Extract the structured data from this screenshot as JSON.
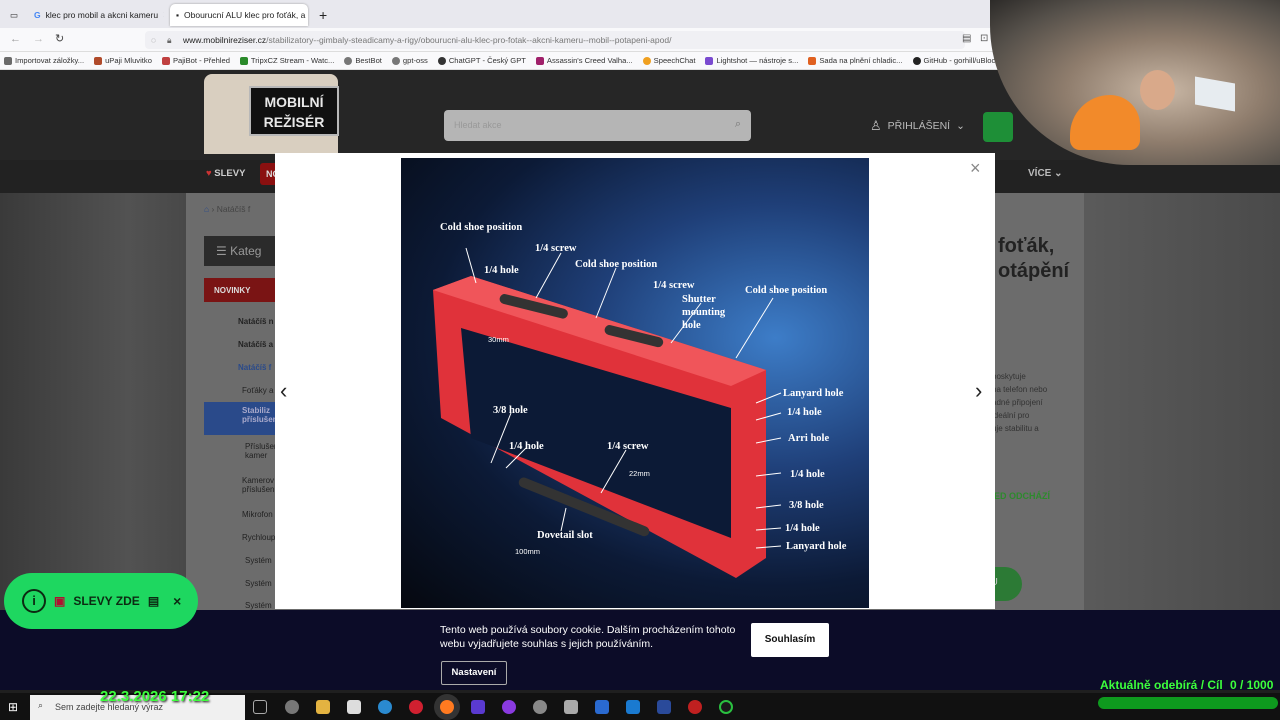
{
  "browser": {
    "tabs": [
      {
        "label": "klec pro mobil a akcni kameru"
      },
      {
        "label": "Obourucní ALU klec pro foťák, a"
      }
    ],
    "url_domain": "www.mobilnireziser.cz",
    "url_path": "/stabilizatory--gimbaly-steadicamy-a-rigy/obourucni-alu-klec-pro-fotak--akcni-kameru--mobil--potapeni-apod/",
    "bookmarks": [
      "Importovat záložky...",
      "uPaji Mluvitko",
      "PajiBot - Přehled",
      "TripxCZ Stream - Watc...",
      "BestBot",
      "gpt-oss",
      "ChatGPT - Český GPT",
      "Assassin's Creed Valha...",
      "SpeechChat",
      "Lightshot — nástroje s...",
      "Sada na plnění chladic...",
      "GitHub - gorhill/uBloc..."
    ]
  },
  "site": {
    "logo_line1": "MOBILNÍ",
    "logo_line2": "REŽISÉR",
    "search_placeholder": "Hledat akce",
    "login": "PŘIHLÁŠENÍ",
    "nav_slevy": "SLEVY",
    "nav_novinky": "NO",
    "nav_vice": "VÍCE",
    "breadcrumb": "Natáčíš f",
    "category_title": "Kateg",
    "sidebar": {
      "novinky": "NOVINKY",
      "items": [
        "Natáčíš n",
        "Natáčíš a",
        "Natáčíš f",
        "Foťáky a",
        "Stabiliz příslušen",
        "Příslušen kamer",
        "Kamerov příslušen",
        "Mikrofon",
        "Rychloup",
        "Systém",
        "Systém",
        "Systém"
      ]
    },
    "product_title_1": "foťák,",
    "product_title_2": "otápění",
    "product_desc": [
      "poskytuje",
      "na telefon nebo",
      "adné připojení",
      "ideální pro",
      "uje stabilitu a"
    ],
    "stock": "ED ODCHÁZÍ",
    "buy": "KU"
  },
  "gallery": {
    "close_label": "×",
    "prev_label": "‹",
    "next_label": "›",
    "labels": [
      "Cold shoe position",
      "1/4 screw",
      "1/4 hole",
      "Cold shoe position",
      "1/4 screw",
      "Shutter mounting hole",
      "Cold shoe position",
      "Lanyard hole",
      "1/4 hole",
      "Arri hole",
      "1/4 hole",
      "3/8 hole",
      "1/4 hole",
      "Lanyard hole",
      "3/8 hole",
      "1/4 hole",
      "1/4 screw",
      "Dovetail slot"
    ],
    "dims": [
      "30mm",
      "22mm",
      "100mm"
    ]
  },
  "cookie": {
    "text": "Tento web používá soubory cookie. Dalším procházením tohoto webu vyjadřujete souhlas s jejich používáním.",
    "agree": "Souhlasím",
    "settings": "Nastavení"
  },
  "promo": {
    "label": "SLEVY ZDE",
    "info": "i",
    "close": "×"
  },
  "overlay": {
    "datetime": "22.3.2026 17:22",
    "subs_label": "Aktuálně odebírá / Cíl",
    "subs_count": "0 / 1000"
  },
  "taskbar": {
    "search_placeholder": "Sem zadejte hledaný výraz"
  },
  "colors": {
    "accent_green": "#1ed760",
    "modal_bg": "#ffffff",
    "cookie_bg": "#0c0c28",
    "frame_red": "#e0323a"
  }
}
